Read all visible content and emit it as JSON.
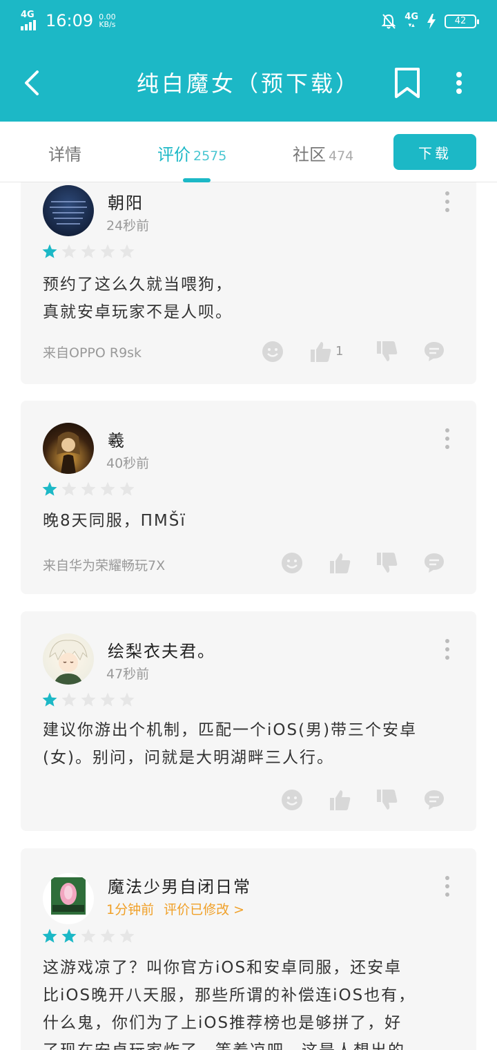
{
  "status": {
    "network": "4G",
    "time": "16:09",
    "speed_value": "0.00",
    "speed_unit": "KB/s",
    "network_right": "4G",
    "battery": "42"
  },
  "header": {
    "title": "纯白魔女（预下载）"
  },
  "tabs": {
    "details": "详情",
    "reviews": "评价",
    "reviews_count": "2575",
    "community": "社区",
    "community_count": "474",
    "download": "下载"
  },
  "colors": {
    "accent": "#1cb8c6",
    "star_on": "#1cb8c6",
    "star_off": "#e6e6e6",
    "edited": "#f0a028"
  },
  "reviews": [
    {
      "name": "朝阳",
      "time": "24秒前",
      "rating": 1,
      "text_lines": [
        "预约了这么久就当喂狗，",
        "真就安卓玩家不是人呗。"
      ],
      "device": "来自OPPO R9sk",
      "likes": "1"
    },
    {
      "name": "羲",
      "time": "40秒前",
      "rating": 1,
      "text_lines": [
        "晚8天同服，ПМŠї"
      ],
      "device": "来自华为荣耀畅玩7X",
      "likes": ""
    },
    {
      "name": "绘梨衣夫君。",
      "time": "47秒前",
      "rating": 1,
      "text_lines": [
        "建议你游出个机制，匹配一个iOS(男)带三个安卓",
        "(女)。别问，问就是大明湖畔三人行。"
      ],
      "device": "",
      "likes": ""
    },
    {
      "name": "魔法少男自闭日常",
      "time": "1分钟前",
      "edited": "评价已修改 >",
      "rating": 2,
      "text_lines": [
        "这游戏凉了？叫你官方iOS和安卓同服，还安卓",
        "比iOS晚开八天服，那些所谓的补偿连iOS也有，",
        "什么鬼，你们为了上iOS推荐榜也是够拼了，好",
        "了现在安卓玩家炸了，等着凉吧，这是人想出的"
      ],
      "device": "",
      "likes": ""
    }
  ]
}
